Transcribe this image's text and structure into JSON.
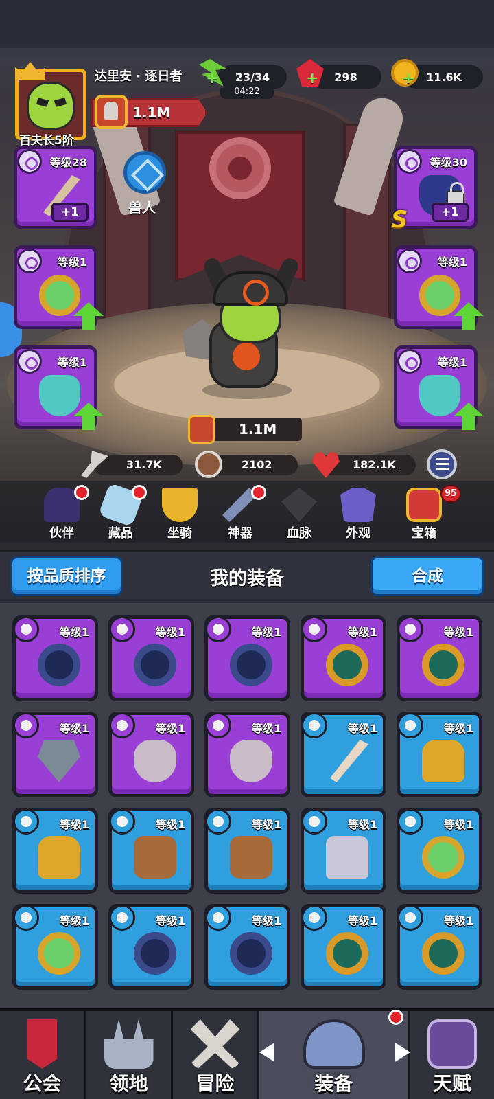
{
  "player": {
    "name": "达里安 · 逐日者",
    "rank": "百夫长5阶",
    "power": "1.1M"
  },
  "resources": {
    "energy": "23/34",
    "energy_timer": "04:22",
    "gems": "298",
    "gold": "11.6K"
  },
  "hero": {
    "race": "兽人",
    "combat_power": "1.1M",
    "stats": {
      "attack": "31.7K",
      "defense": "2102",
      "health": "182.1K"
    }
  },
  "equipped": {
    "left": [
      {
        "level": "等级28",
        "type": "weapon-icon",
        "extra": "+1",
        "upgrade": false
      },
      {
        "level": "等级1",
        "type": "ring-icon",
        "extra": "",
        "upgrade": true
      },
      {
        "level": "等级1",
        "type": "amulet-icon",
        "extra": "",
        "upgrade": true
      }
    ],
    "right": [
      {
        "level": "等级30",
        "type": "helmet-icon",
        "extra": "+1",
        "grade": "S",
        "locked": true,
        "upgrade": false
      },
      {
        "level": "等级1",
        "type": "ring-icon",
        "extra": "",
        "upgrade": true
      },
      {
        "level": "等级1",
        "type": "amulet-icon",
        "extra": "",
        "upgrade": true
      }
    ]
  },
  "features": [
    {
      "label": "伙伴",
      "icon": "companion-icon",
      "dot": true
    },
    {
      "label": "藏品",
      "icon": "collection-icon",
      "dot": true
    },
    {
      "label": "坐骑",
      "icon": "mount-icon",
      "dot": false
    },
    {
      "label": "神器",
      "icon": "artifact-icon",
      "dot": true
    },
    {
      "label": "血脉",
      "icon": "bloodline-icon",
      "dot": false
    },
    {
      "label": "外观",
      "icon": "appearance-icon",
      "dot": false
    },
    {
      "label": "宝箱",
      "icon": "chest-icon",
      "dot": false,
      "badge": "95"
    }
  ],
  "inventory": {
    "sort_label": "按品质排序",
    "title": "我的装备",
    "craft_label": "合成",
    "items": [
      {
        "rarity": "purple",
        "type": "ring",
        "art": "art-ring-dark",
        "level": "等级1"
      },
      {
        "rarity": "purple",
        "type": "ring",
        "art": "art-ring-dark",
        "level": "等级1"
      },
      {
        "rarity": "purple",
        "type": "ring",
        "art": "art-ring-dark",
        "level": "等级1"
      },
      {
        "rarity": "purple",
        "type": "ring",
        "art": "art-ring-gold",
        "level": "等级1"
      },
      {
        "rarity": "purple",
        "type": "ring",
        "art": "art-ring-gold",
        "level": "等级1"
      },
      {
        "rarity": "purple",
        "type": "amulet",
        "art": "art-amulet",
        "level": "等级1"
      },
      {
        "rarity": "purple",
        "type": "amulet",
        "art": "art-mask",
        "level": "等级1"
      },
      {
        "rarity": "purple",
        "type": "amulet",
        "art": "art-mask",
        "level": "等级1"
      },
      {
        "rarity": "blue",
        "type": "weapon",
        "art": "art-bow",
        "level": "等级1"
      },
      {
        "rarity": "blue",
        "type": "armor",
        "art": "art-armor-gold",
        "level": "等级1"
      },
      {
        "rarity": "blue",
        "type": "armor",
        "art": "art-armor-gold",
        "level": "等级1"
      },
      {
        "rarity": "blue",
        "type": "armor",
        "art": "art-vest",
        "level": "等级1"
      },
      {
        "rarity": "blue",
        "type": "armor",
        "art": "art-vest",
        "level": "等级1"
      },
      {
        "rarity": "blue",
        "type": "armor",
        "art": "art-plate",
        "level": "等级1"
      },
      {
        "rarity": "blue",
        "type": "ring",
        "art": "art-ring-green",
        "level": "等级1"
      },
      {
        "rarity": "blue",
        "type": "ring",
        "art": "art-ring-green",
        "level": "等级1"
      },
      {
        "rarity": "blue",
        "type": "ring",
        "art": "art-ring-dark",
        "level": "等级1"
      },
      {
        "rarity": "blue",
        "type": "ring",
        "art": "art-ring-dark",
        "level": "等级1"
      },
      {
        "rarity": "blue",
        "type": "ring",
        "art": "art-ring-gold",
        "level": "等级1"
      },
      {
        "rarity": "blue",
        "type": "ring",
        "art": "art-ring-gold",
        "level": "等级1"
      }
    ]
  },
  "nav": {
    "tabs": [
      {
        "label": "公会",
        "icon": "guild-icon"
      },
      {
        "label": "领地",
        "icon": "territory-icon"
      },
      {
        "label": "冒险",
        "icon": "adventure-icon"
      },
      {
        "label": "装备",
        "icon": "equipment-icon",
        "active": true,
        "dot": true
      },
      {
        "label": "天赋",
        "icon": "talent-icon"
      }
    ]
  },
  "colors": {
    "purple_rarity": "#9a3fd6",
    "blue_rarity": "#2f9fde",
    "button_blue": "#2f9cf0",
    "upgrade_green": "#5ed437",
    "notification_red": "#e4242c"
  }
}
